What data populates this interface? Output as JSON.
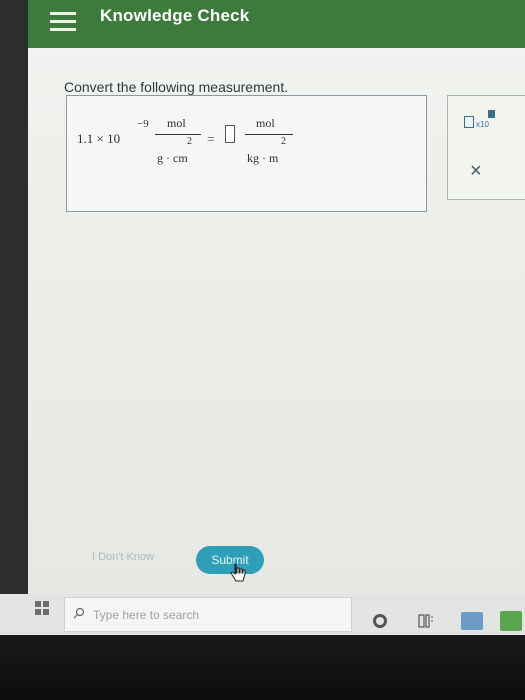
{
  "header": {
    "title": "Knowledge Check",
    "menu_icon": "hamburger-menu-icon",
    "color": "#3d7a3b"
  },
  "question": {
    "prompt": "Convert the following measurement.",
    "coefficient": "1.1 × 10",
    "exponent": "−9",
    "given_unit": {
      "numerator": "mol",
      "denominator": "g · cm",
      "denominator_exp": "2"
    },
    "equals": "=",
    "answer_value": "",
    "target_unit": {
      "numerator": "mol",
      "denominator": "kg · m",
      "denominator_exp": "2"
    }
  },
  "tools": {
    "scientific_notation_label": "x10",
    "close_icon": "close-x-icon",
    "close_glyph": "×"
  },
  "actions": {
    "dont_know_label": "I Don't Know",
    "submit_label": "Submit",
    "submit_color": "#2e9fb7"
  },
  "taskbar": {
    "search_placeholder": "Type here to search",
    "start_icon": "windows-logo-icon",
    "search_icon": "search-icon",
    "cortana_icon": "cortana-circle-icon",
    "task_view_icon": "task-view-icon"
  }
}
